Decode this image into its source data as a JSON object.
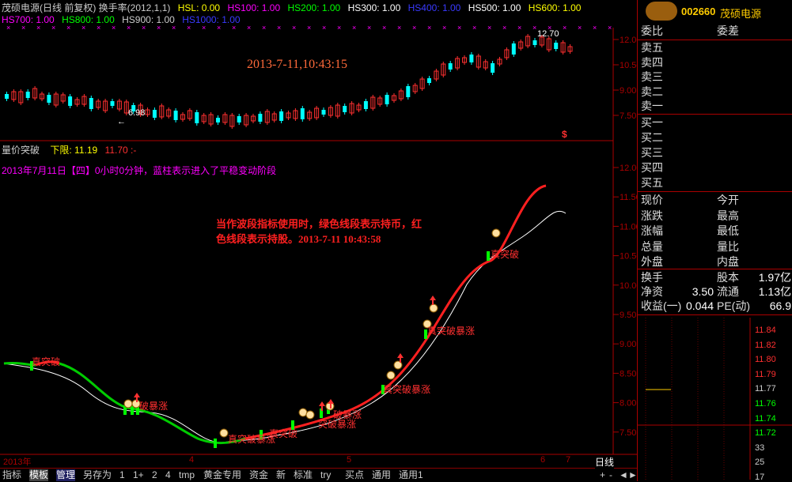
{
  "header": {
    "title": "茂硕电源(日线 前复权) 换手率(2012,1,1)",
    "hsl": "HSL: 0.00",
    "hs100": "HS100: 1.00",
    "hs200": "HS200: 1.00",
    "hs300": "HS300: 1.00",
    "hs400": "HS400: 1.00",
    "hs500": "HS500: 1.00",
    "hs600": "HS600: 1.00",
    "hs700": "HS700: 1.00",
    "hs800": "HS800: 1.00",
    "hs900": "HS900: 1.00",
    "hs1000": "HS1000: 1.00",
    "colors": {
      "title": "#cccccc",
      "hsl": "#ffff00",
      "hs100": "#ff00ff",
      "hs200": "#00ff00",
      "hs300": "#ffffff",
      "hs400": "#3030ff",
      "hs500": "#ffffff",
      "hs600": "#ffff00",
      "hs700": "#ff00ff",
      "hs800": "#00ff00",
      "hs900": "#cccccc",
      "hs1000": "#3030ff"
    }
  },
  "upper_chart": {
    "timestamp": "2013-7-11,10:43:15",
    "low_label": "6.98",
    "high_label": "12.70",
    "y_ticks": [
      "12.00",
      "10.50",
      "9.00",
      "7.50"
    ],
    "dollar_marker": "$"
  },
  "indicator": {
    "name": "量价突破",
    "lower_label": "下限:",
    "lower_value": "11.19",
    "upper_value": "11.70",
    "tail": ":-",
    "info_line": "2013年7月11日【四】0小时0分钟，蓝柱表示进入了平稳变动阶段",
    "note": "当作波段指标使用时，绿色线段表示持币，红色线段表示持股。2013-7-11 10:43:58",
    "y_ticks": [
      "12.00",
      "11.50",
      "11.00",
      "10.50",
      "10.00",
      "9.50",
      "9.00",
      "8.50",
      "8.00",
      "7.50"
    ],
    "signal_labels": [
      "真突破",
      "破暴涨",
      "真突破暴涨",
      "真突破",
      "破暴涨",
      "突破暴涨",
      "真突破暴涨",
      "真突破暴涨",
      "真突破"
    ]
  },
  "x_axis": {
    "labels": [
      "2013年",
      "4",
      "5",
      "6",
      "7"
    ]
  },
  "right_panel": {
    "code": "002660",
    "name": "茂硕电源",
    "weibi": "委比",
    "weicha": "委差",
    "sell": [
      "卖五",
      "卖四",
      "卖三",
      "卖二",
      "卖一"
    ],
    "buy": [
      "买一",
      "买二",
      "买三",
      "买四",
      "买五"
    ],
    "stats_left": [
      "现价",
      "涨跌",
      "涨幅",
      "总量",
      "外盘"
    ],
    "stats_right": [
      "今开",
      "最高",
      "最低",
      "量比",
      "内盘"
    ],
    "huanshou": "换手",
    "guben": "股本",
    "guben_val": "1.97亿",
    "jingzi": "净资",
    "jingzi_val": "3.50",
    "liutong": "流通",
    "liutong_val": "1.13亿",
    "shouyi": "收益(一)",
    "shouyi_val": "0.044",
    "pe": "PE(动)",
    "pe_val": "66.9",
    "mini_ticks": [
      "11.84",
      "11.82",
      "11.80",
      "11.79",
      "11.77",
      "11.76",
      "11.74",
      "11.72",
      "33",
      "25",
      "17"
    ]
  },
  "tabs": [
    "指标",
    "模板",
    "管理",
    "另存为",
    "1",
    "1+",
    "2",
    "4",
    "tmp",
    "黄金专用",
    "资金",
    "新",
    "标准",
    "try",
    "买点",
    "通用",
    "通用1"
  ],
  "period": "日线",
  "nav_buttons": [
    "+",
    "-",
    "◄",
    "►"
  ]
}
